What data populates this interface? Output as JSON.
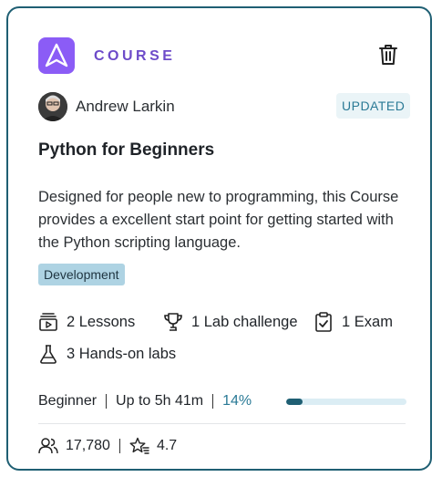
{
  "card": {
    "type_label": "COURSE",
    "author": "Andrew Larkin",
    "badge": "UPDATED",
    "title": "Python for Beginners",
    "description": "Designed for people new to programming, this Course provides a excellent start point for getting started with the Python scripting language.",
    "tag": "Development",
    "contents": {
      "lessons": "2 Lessons",
      "lab_challenge": "1 Lab challenge",
      "exam": "1 Exam",
      "hands_on_labs": "3 Hands-on labs"
    },
    "stats": {
      "level": "Beginner",
      "duration": "Up to 5h 41m",
      "progress_label": "14%",
      "progress_value": 0.14
    },
    "footer": {
      "enrollments": "17,780",
      "rating": "4.7"
    }
  },
  "colors": {
    "border": "#1f5f73",
    "logo_bg": "#8b5cf6",
    "type_label": "#6d4bc9",
    "badge_text": "#2a7a96",
    "tag_bg": "#aed3e3",
    "progress_fill": "#1f5f73",
    "progress_track": "#dbedf4"
  },
  "icons": [
    "logo-icon",
    "trash-icon",
    "lessons-icon",
    "trophy-icon",
    "clipboard-check-icon",
    "flask-icon",
    "users-icon",
    "star-icon"
  ]
}
